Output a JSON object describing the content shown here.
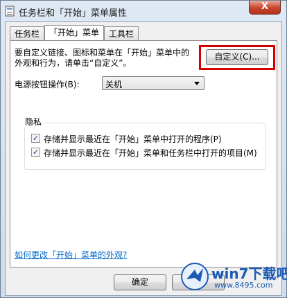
{
  "window": {
    "title": "任务栏和「开始」菜单属性",
    "close_label": "X"
  },
  "tabs": [
    {
      "label": "任务栏",
      "active": false
    },
    {
      "label": "「开始」菜单",
      "active": true
    },
    {
      "label": "工具栏",
      "active": false
    }
  ],
  "start_menu": {
    "description_line1": "要自定义链接、图标和菜单在「开始」菜单中的",
    "description_line2": "外观和行为，请单击“自定义”。",
    "customize_button": "自定义(C)...",
    "power_label": "电源按钮操作(B):",
    "power_value": "关机",
    "privacy_group": "隐私",
    "privacy_items": [
      {
        "label": "存储并显示最近在「开始」菜单中打开的程序(P)",
        "checked": true
      },
      {
        "label": "存储并显示最近在「开始」菜单和任务栏中打开的项目(M)",
        "checked": true
      }
    ],
    "help_link": "如何更改「开始」菜单的外观?"
  },
  "footer": {
    "ok_button": "确定"
  },
  "watermark": {
    "brand": "win7下载吧",
    "url": "www.8495.com"
  },
  "colors": {
    "highlight": "#d40000",
    "link": "#0066cc",
    "watermark": "#1b5bb5"
  }
}
